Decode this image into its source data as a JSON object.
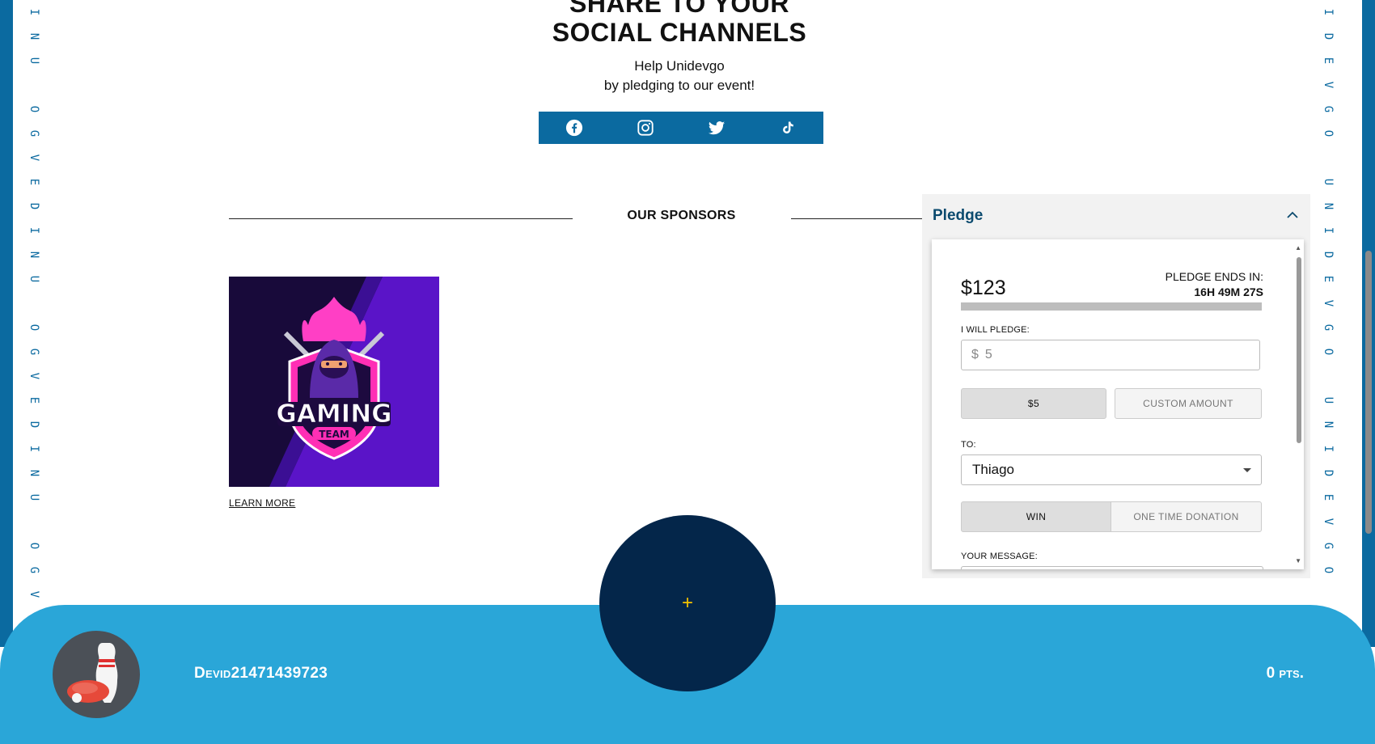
{
  "share": {
    "title_line1": "SHARE TO YOUR",
    "title_line2": "SOCIAL CHANNELS",
    "sub_line1": "Help Unidevgo",
    "sub_line2": "by pledging to our event!",
    "icons": [
      "facebook-icon",
      "instagram-icon",
      "twitter-icon",
      "tiktok-icon"
    ]
  },
  "sponsors": {
    "title": "OUR SPONSORS",
    "logo_text": "GAMING",
    "logo_subtext": "TEAM",
    "learn_more": "LEARN MORE"
  },
  "pledge": {
    "title": "Pledge",
    "amount": "$123",
    "ends_label": "PLEDGE ENDS IN:",
    "ends_time": "16H 49M 27S",
    "will_pledge_label": "I WILL PLEDGE:",
    "currency": "$",
    "input_placeholder": "5",
    "preset_button": "$5",
    "custom_button": "CUSTOM AMOUNT",
    "to_label": "TO:",
    "to_value": "Thiago",
    "type_win": "WIN",
    "type_donation": "ONE TIME DONATION",
    "message_label": "YOUR MESSAGE:"
  },
  "footer": {
    "username": "Devid21471439723",
    "points": "0 pts.",
    "fab_symbol": "+"
  },
  "colors": {
    "brand_dark": "#0b6aa0",
    "footer": "#2aa6d8",
    "fab": "#04264a",
    "fab_plus": "#f5c300",
    "pledge_title": "#0b4a6e"
  }
}
